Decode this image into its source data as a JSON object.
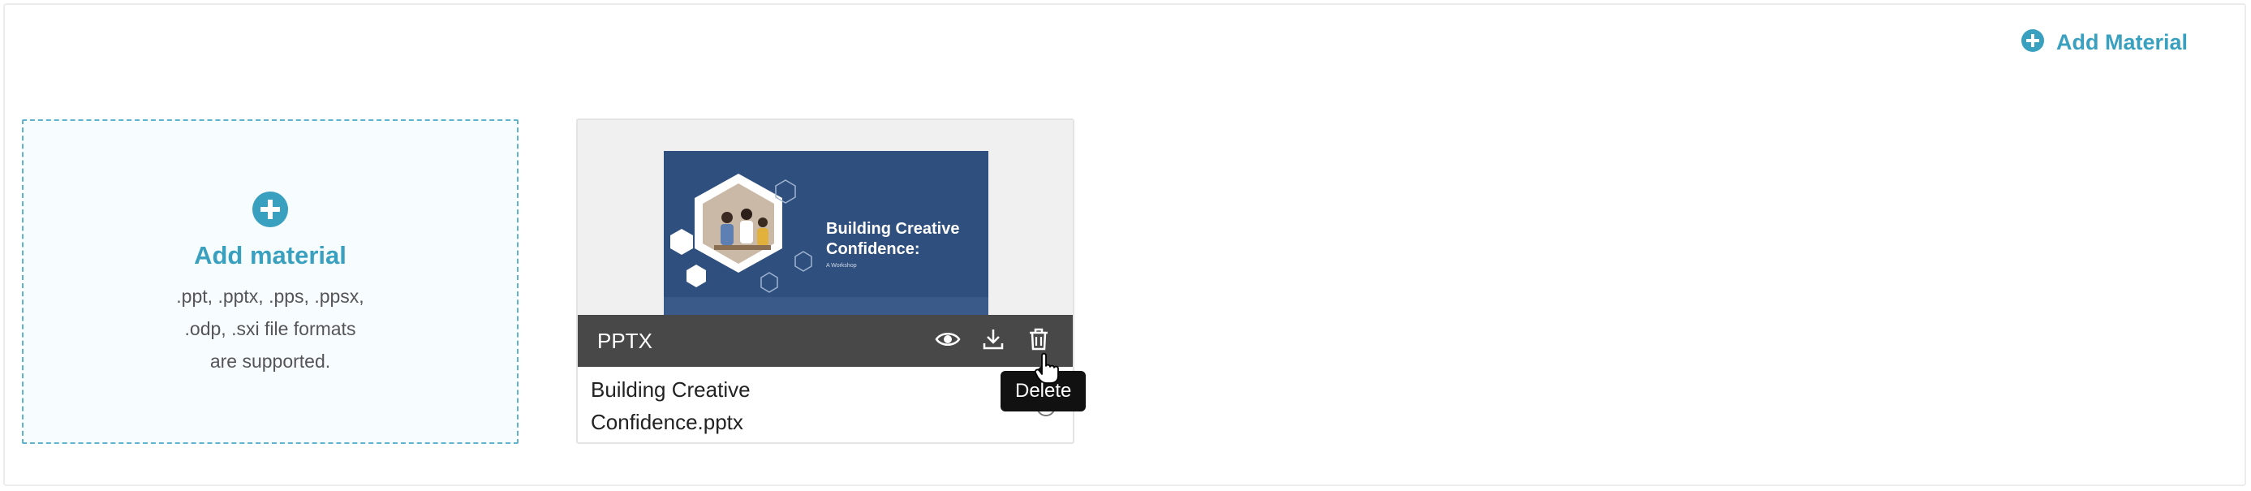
{
  "header": {
    "add_material_label": "Add Material"
  },
  "add_tile": {
    "title": "Add material",
    "formats_line1": ".ppt, .pptx, .pps, .ppsx,",
    "formats_line2": ".odp, .sxi file formats",
    "formats_line3": "are supported."
  },
  "file": {
    "type": "PPTX",
    "name_line1": "Building Creative",
    "name_line2": "Confidence.pptx",
    "thumbnail": {
      "title_line1": "Building Creative",
      "title_line2": "Confidence:",
      "subtitle": "A Workshop"
    },
    "actions": [
      "eye-icon",
      "download-icon",
      "trash-icon"
    ]
  },
  "tooltip": {
    "text": "Delete"
  },
  "colors": {
    "accent": "#3aa0bf",
    "bar": "#3a3a3a",
    "slide_bg": "#2f4f7e",
    "tooltip_bg": "#111111"
  }
}
